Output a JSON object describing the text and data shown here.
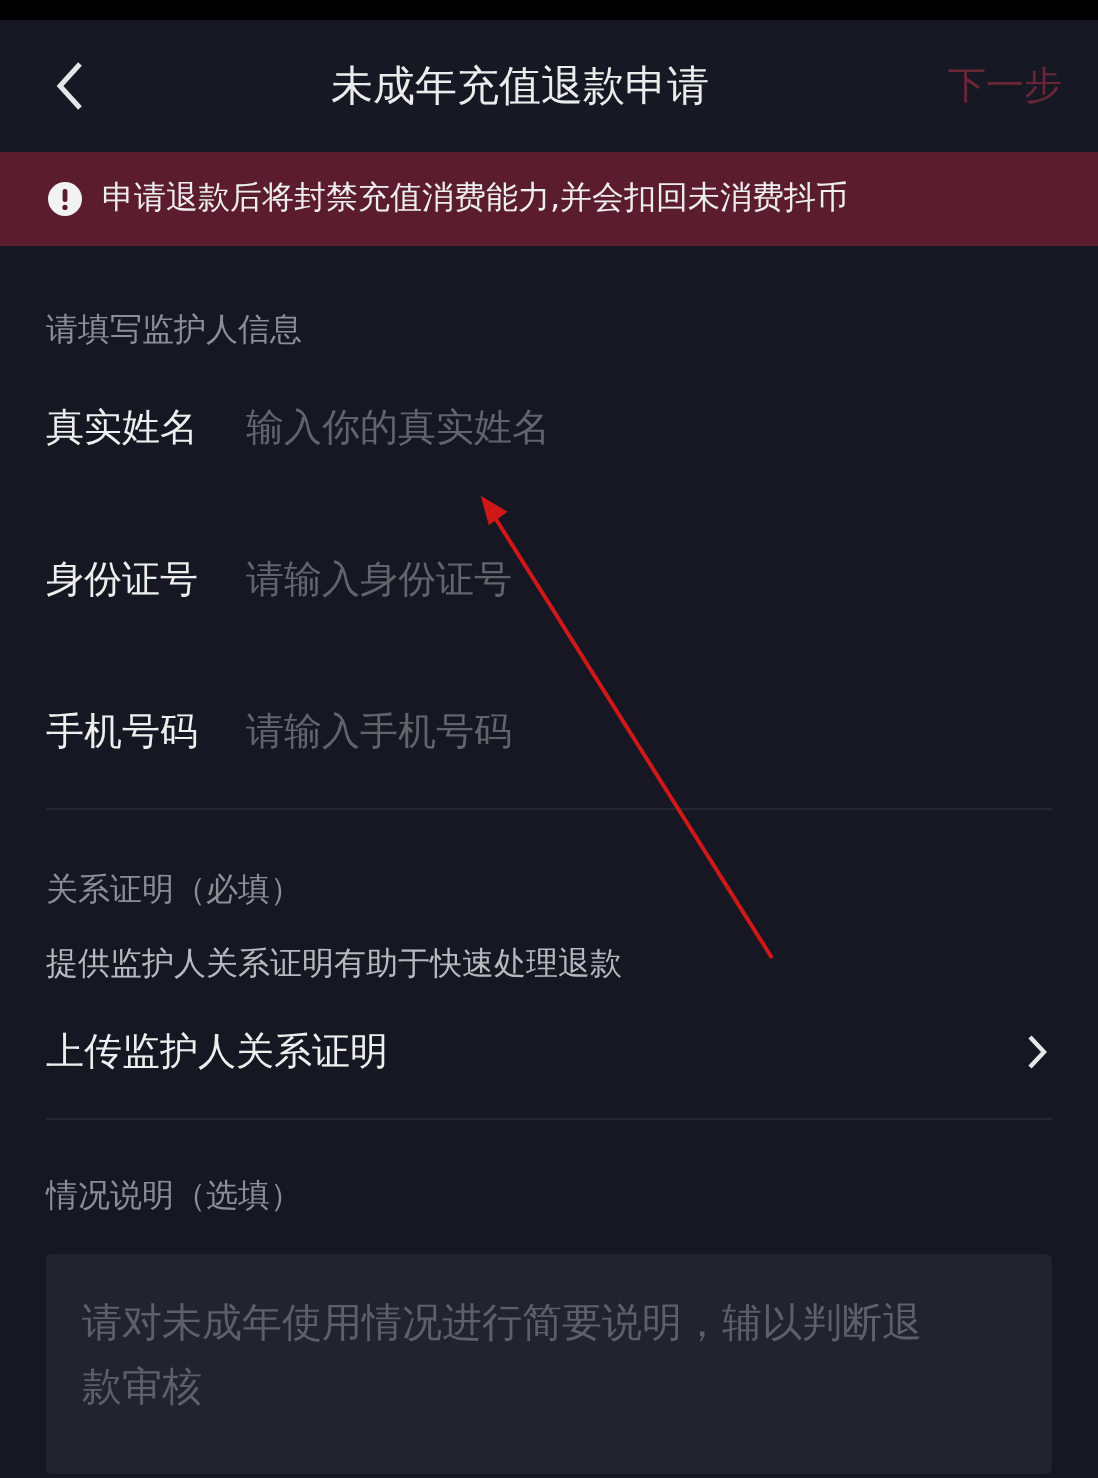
{
  "nav": {
    "title": "未成年充值退款申请",
    "next": {
      "label": "下一步",
      "disabled": true
    }
  },
  "banner": {
    "text": "申请退款后将封禁充值消费能力,并会扣回未消费抖币"
  },
  "guardian": {
    "heading": "请填写监护人信息",
    "fields": [
      {
        "label": "真实姓名",
        "placeholder": "输入你的真实姓名"
      },
      {
        "label": "身份证号",
        "placeholder": "请输入身份证号"
      },
      {
        "label": "手机号码",
        "placeholder": "请输入手机号码"
      }
    ]
  },
  "relation": {
    "heading": "关系证明（必填）",
    "hint": "提供监护人关系证明有助于快速处理退款",
    "upload": "上传监护人关系证明"
  },
  "description": {
    "heading": "情况说明（选填）",
    "placeholder": "请对未成年使用情况进行简要说明，辅以判断退款审核"
  }
}
